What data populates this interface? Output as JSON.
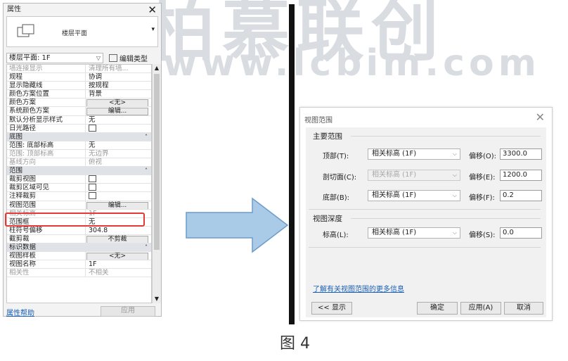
{
  "watermark": {
    "big": "柏慕联创",
    "url": "www.lcbim.com"
  },
  "properties": {
    "title": "属性",
    "type_name": "楼层平面",
    "instance_combo": "楼层平面: 1F",
    "edit_type": "编辑类型",
    "rows": [
      {
        "kind": "row",
        "k": "墙连接显示",
        "v": "清理所有墙...",
        "grey": true
      },
      {
        "kind": "row",
        "k": "规程",
        "v": "协调"
      },
      {
        "kind": "row",
        "k": "显示隐藏线",
        "v": "按规程"
      },
      {
        "kind": "row",
        "k": "颜色方案位置",
        "v": "背景"
      },
      {
        "kind": "row",
        "k": "颜色方案",
        "btn": "<无>"
      },
      {
        "kind": "row",
        "k": "系统颜色方案",
        "btn": "编辑..."
      },
      {
        "kind": "row",
        "k": "默认分析显示样式",
        "v": "无"
      },
      {
        "kind": "row",
        "k": "日光路径",
        "check": true
      },
      {
        "kind": "section",
        "k": "底图"
      },
      {
        "kind": "row",
        "k": "范围: 底部标高",
        "v": "无"
      },
      {
        "kind": "row",
        "k": "范围: 顶部标高",
        "v": "无边界",
        "grey": true
      },
      {
        "kind": "row",
        "k": "基线方向",
        "v": "俯视",
        "grey": true
      },
      {
        "kind": "section",
        "k": "范围"
      },
      {
        "kind": "row",
        "k": "裁剪视图",
        "check": true
      },
      {
        "kind": "row",
        "k": "裁剪区域可见",
        "check": true
      },
      {
        "kind": "row",
        "k": "注释裁剪",
        "check": true
      },
      {
        "kind": "row",
        "k": "视图范围",
        "btn": "编辑..."
      },
      {
        "kind": "row",
        "k": "相关标高",
        "v": "1F",
        "grey": true
      },
      {
        "kind": "row",
        "k": "范围框",
        "v": "无"
      },
      {
        "kind": "row",
        "k": "柱符号偏移",
        "v": "304.8"
      },
      {
        "kind": "row",
        "k": "截剪裁",
        "btn": "不剪裁"
      },
      {
        "kind": "section",
        "k": "标识数据"
      },
      {
        "kind": "row",
        "k": "视图样板",
        "btn": "<无>"
      },
      {
        "kind": "row",
        "k": "视图名称",
        "v": "1F"
      },
      {
        "kind": "row",
        "k": "相关性",
        "v": "不相关",
        "grey": true
      }
    ],
    "help_link": "属性帮助",
    "apply": "应用"
  },
  "dialog": {
    "title": "视图范围",
    "primary_group": "主要范围",
    "top_label": "顶部(T):",
    "top_value": "相关标高 (1F)",
    "top_offset_label": "偏移(O):",
    "top_offset": "3300.0",
    "cut_label": "剖切面(C):",
    "cut_value": "相关标高 (1F)",
    "cut_offset_label": "偏移(E):",
    "cut_offset": "1200.0",
    "bottom_label": "底部(B):",
    "bottom_value": "相关标高 (1F)",
    "bottom_offset_label": "偏移(F):",
    "bottom_offset": "0.2",
    "depth_group": "视图深度",
    "level_label": "标高(L):",
    "level_value": "相关标高 (1F)",
    "level_offset_label": "偏移(S):",
    "level_offset": "0.0",
    "more_link": "了解有关视图范围的更多信息",
    "show_button": "<< 显示",
    "ok_button": "确定",
    "apply_button": "应用(A)",
    "cancel_button": "取消"
  },
  "caption": "图 4",
  "colors": {
    "highlight": "#e53935",
    "arrow_fill": "#a9cbe8",
    "arrow_stroke": "#6d9bc9",
    "link": "#1a5fb4"
  }
}
